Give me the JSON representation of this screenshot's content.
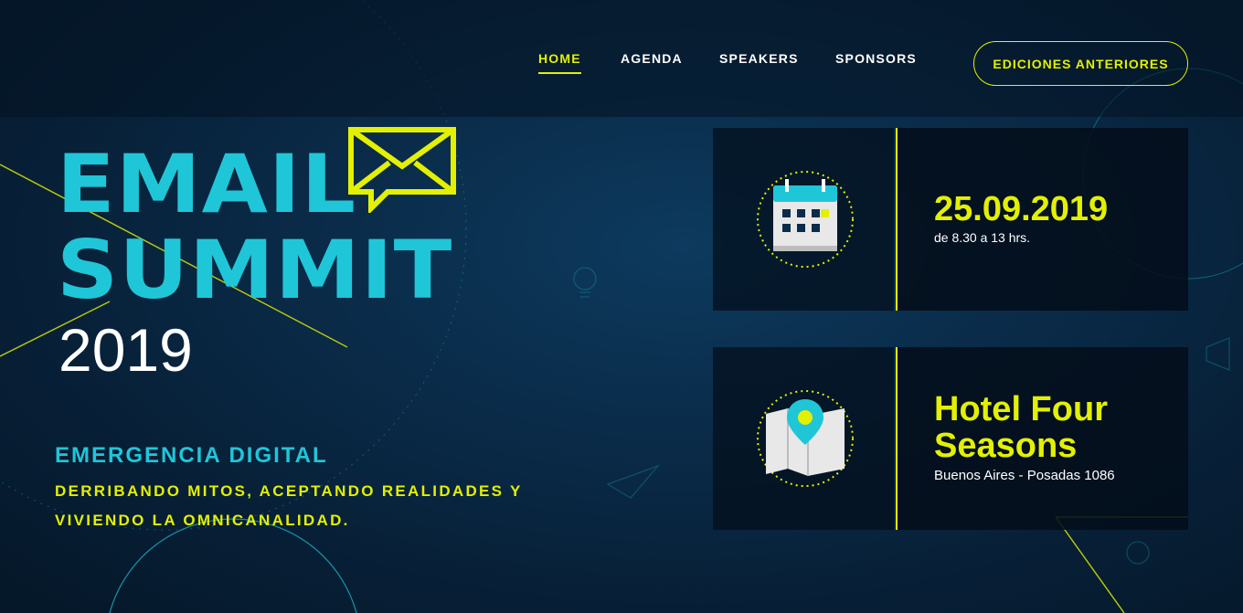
{
  "nav": {
    "items": [
      {
        "label": "HOME",
        "active": true
      },
      {
        "label": "AGENDA",
        "active": false
      },
      {
        "label": "SPEAKERS",
        "active": false
      },
      {
        "label": "SPONSORS",
        "active": false
      }
    ],
    "cta_label": "EDICIONES ANTERIORES"
  },
  "hero": {
    "logo_line1": "EMAIL",
    "logo_line2": "SUMMIT",
    "year": "2019",
    "subtitle": "EMERGENCIA DIGITAL",
    "tagline_line1": "DERRIBANDO MITOS, ACEPTANDO REALIDADES Y",
    "tagline_line2": "VIVIENDO LA OMNICANALIDAD."
  },
  "event": {
    "date": "25.09.2019",
    "time": "de 8.30 a 13 hrs.",
    "venue_line1": "Hotel Four",
    "venue_line2": "Seasons",
    "address": "Buenos Aires - Posadas 1086",
    "date_icon": "calendar-icon",
    "venue_icon": "map-pin-icon"
  },
  "colors": {
    "accent_yellow": "#e3f000",
    "accent_cyan": "#1fc6d8",
    "background": "#0a2c4a"
  }
}
